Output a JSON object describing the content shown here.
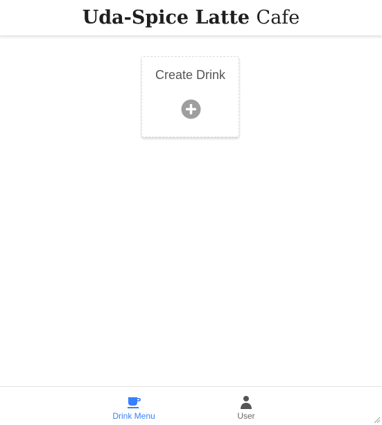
{
  "header": {
    "title_bold": "Uda-Spice Latte",
    "title_light": "Cafe"
  },
  "card": {
    "label": "Create Drink",
    "icon": "add-circle-icon"
  },
  "tabs": [
    {
      "label": "Drink Menu",
      "icon": "cafe-cup-icon",
      "active": true
    },
    {
      "label": "User",
      "icon": "person-icon",
      "active": false
    }
  ],
  "colors": {
    "accent": "#3880ff",
    "inactive": "#666666",
    "icon_gray": "#9e9e9e"
  }
}
